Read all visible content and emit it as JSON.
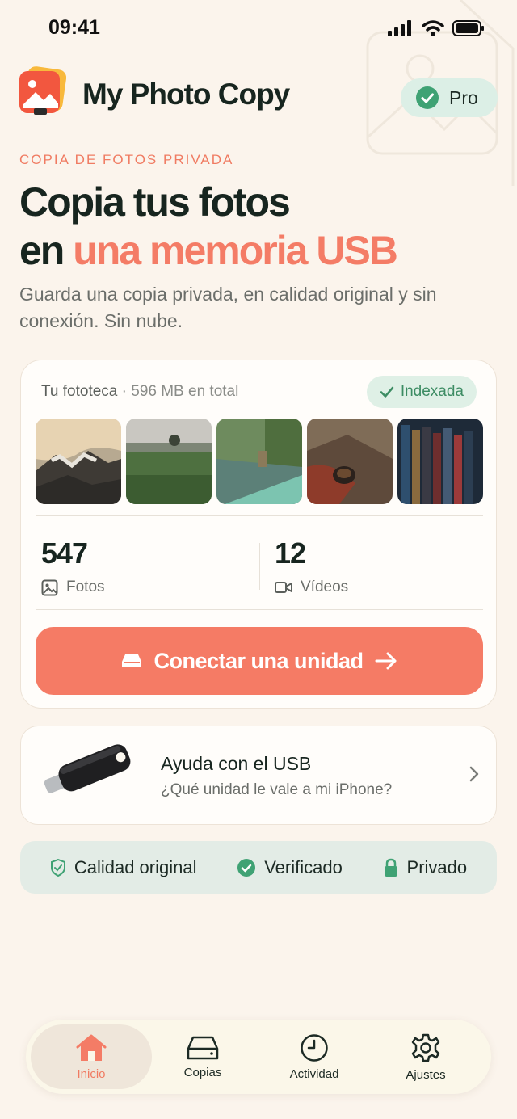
{
  "status_bar": {
    "time": "09:41"
  },
  "header": {
    "app_title": "My Photo Copy",
    "pro_label": "Pro"
  },
  "hero": {
    "eyebrow": "COPIA DE FOTOS PRIVADA",
    "title_line1": "Copia tus fotos",
    "title_line2_prefix": "en ",
    "title_line2_accent": "una memoria USB",
    "subtitle": "Guarda una copia privada, en calidad original y sin conexión. Sin nube."
  },
  "library": {
    "label": "Tu fototeca",
    "separator": " · ",
    "size_text": "596 MB en total",
    "indexed_label": "Indexada",
    "thumbnails": [
      "mountain",
      "meadow",
      "river",
      "coffee",
      "books"
    ],
    "photos_count": "547",
    "photos_label": "Fotos",
    "videos_count": "12",
    "videos_label": "Vídeos",
    "cta_label": "Conectar una unidad"
  },
  "help": {
    "title": "Ayuda con el USB",
    "subtitle": "¿Qué unidad le vale a mi iPhone?"
  },
  "trust": [
    {
      "icon": "shield-check-icon",
      "label": "Calidad original"
    },
    {
      "icon": "check-circle-icon",
      "label": "Verificado"
    },
    {
      "icon": "lock-icon",
      "label": "Privado"
    }
  ],
  "tabs": [
    {
      "icon": "home-icon",
      "label": "Inicio",
      "active": true
    },
    {
      "icon": "drive-icon",
      "label": "Copias",
      "active": false
    },
    {
      "icon": "clock-icon",
      "label": "Actividad",
      "active": false
    },
    {
      "icon": "gear-icon",
      "label": "Ajustes",
      "active": false
    }
  ],
  "colors": {
    "accent": "#F57B65",
    "green": "#3FA274",
    "background": "#FBF4EC"
  }
}
